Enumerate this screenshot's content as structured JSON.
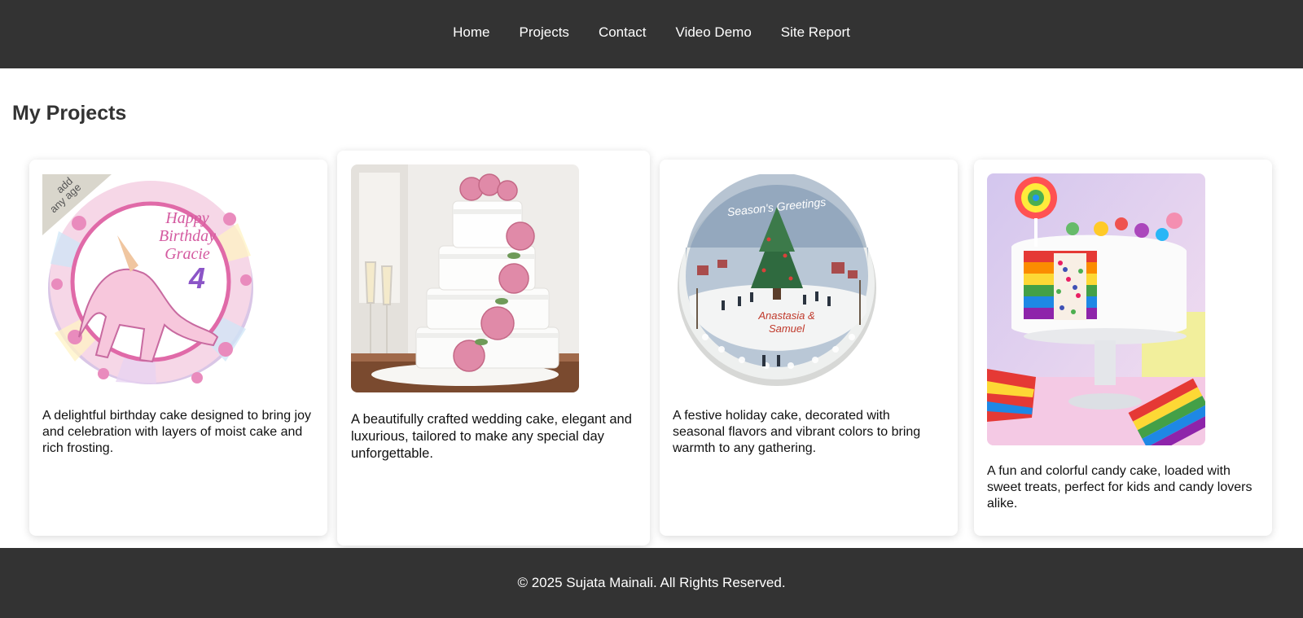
{
  "nav": {
    "items": [
      "Home",
      "Projects",
      "Contact",
      "Video Demo",
      "Site Report"
    ]
  },
  "page_title": "My Projects",
  "projects": [
    {
      "description": "A delightful birthday cake designed to bring joy and celebration with layers of moist cake and rich frosting.",
      "image_text": [
        "add",
        "any age",
        "Happy",
        "Birthday",
        "Gracie",
        "4"
      ]
    },
    {
      "description": "A beautifully crafted wedding cake, elegant and luxurious, tailored to make any special day unforgettable."
    },
    {
      "description": "A festive holiday cake, decorated with seasonal flavors and vibrant colors to bring warmth to any gathering.",
      "image_text": [
        "Season's Greetings",
        "Anastasia &",
        "Samuel"
      ]
    },
    {
      "description": "A fun and colorful candy cake, loaded with sweet treats, perfect for kids and candy lovers alike."
    }
  ],
  "footer": {
    "text": "© 2025 Sujata Mainali. All Rights Reserved."
  },
  "colors": {
    "nav_bg": "#333333",
    "footer_bg": "#333333",
    "nav_text": "#ffffff",
    "title_text": "#333333"
  }
}
